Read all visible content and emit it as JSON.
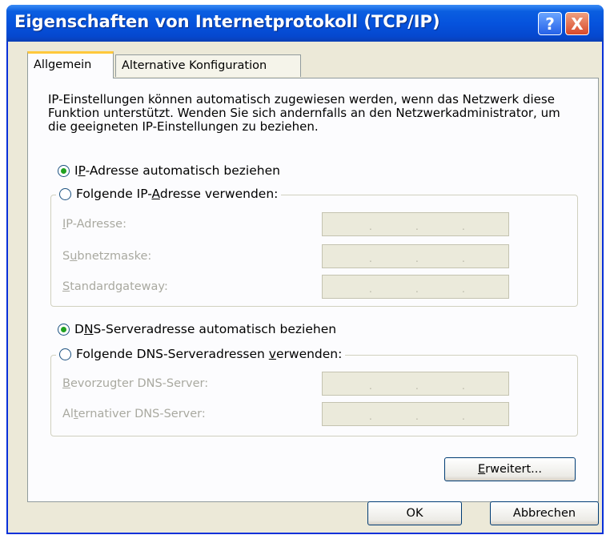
{
  "window": {
    "title": "Eigenschaften von Internetprotokoll (TCP/IP)",
    "help_label": "?",
    "close_label": "X"
  },
  "tabs": [
    {
      "label": "Allgemein",
      "active": true
    },
    {
      "label": "Alternative Konfiguration",
      "active": false
    }
  ],
  "intro_text": "IP-Einstellungen können automatisch zugewiesen werden, wenn das Netzwerk diese Funktion unterstützt. Wenden Sie sich andernfalls an den Netzwerkadministrator, um die geeigneten IP-Einstellungen zu beziehen.",
  "ip_section": {
    "auto_option": {
      "pre": "I",
      "key": "P",
      "post": "-Adresse automatisch beziehen",
      "checked": true
    },
    "manual_option": {
      "pre": "Folgende IP-",
      "key": "A",
      "post": "dresse verwenden:",
      "checked": false
    },
    "fields": [
      {
        "key": "I",
        "rest": "P-Adresse:",
        "value": ""
      },
      {
        "pre": "S",
        "key": "u",
        "rest": "bnetzmaske:",
        "value": ""
      },
      {
        "key": "S",
        "rest": "tandardgateway:",
        "value": ""
      }
    ]
  },
  "dns_section": {
    "auto_option": {
      "pre": "D",
      "key": "N",
      "post": "S-Serveradresse automatisch beziehen",
      "checked": true
    },
    "manual_option": {
      "pre": "Folgende DNS-Serveradressen ",
      "key": "v",
      "post": "erwenden:",
      "checked": false
    },
    "fields": [
      {
        "key": "B",
        "rest": "evorzugter DNS-Server:",
        "value": ""
      },
      {
        "pre": "Al",
        "key": "t",
        "rest": "ernativer DNS-Server:",
        "value": ""
      }
    ]
  },
  "buttons": {
    "advanced": {
      "key": "E",
      "rest": "rweitert..."
    },
    "ok": "OK",
    "cancel": "Abbrechen"
  },
  "colors": {
    "titlebar": "#0653dd",
    "dialog_bg": "#ece9d8",
    "tab_highlight": "#ffc83c",
    "radio_dot": "#21a121"
  }
}
